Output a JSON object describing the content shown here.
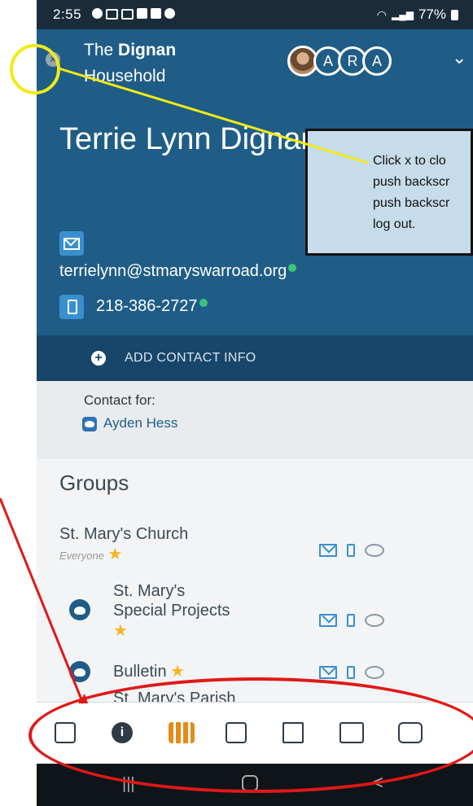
{
  "status_bar": {
    "time": "2:55",
    "battery": "77%"
  },
  "header": {
    "close_symbol": "×",
    "household_prefix": "The ",
    "household_name": "Dignan",
    "household_suffix": "Household",
    "avatar_letters": [
      "A",
      "R",
      "A"
    ],
    "chevron": "⌄"
  },
  "profile": {
    "name": "Terrie Lynn Dignan",
    "email": "terrielynn@stmaryswarroad.org",
    "phone": "218-386-2727"
  },
  "add_contact_label": "ADD CONTACT INFO",
  "contact_for": {
    "label": "Contact for:",
    "name": "Ayden Hess"
  },
  "groups": {
    "title": "Groups",
    "items": [
      {
        "name": "St. Mary's Church",
        "sub": "Everyone"
      },
      {
        "name_line1": "St. Mary's",
        "name_line2": "Special Projects"
      },
      {
        "name": "Bulletin"
      },
      {
        "name": "St. Mary's Parish"
      }
    ]
  },
  "bottom_nav": [
    "directory-icon",
    "info-icon",
    "groups-icon",
    "notes-icon",
    "copy-icon",
    "giving-icon",
    "wallet-icon"
  ],
  "android_nav": {
    "recent": "|||",
    "back": "<"
  },
  "callout": {
    "lines": [
      "Click x to clo",
      "push backscr",
      "push backscr",
      "log out."
    ]
  },
  "colors": {
    "primary": "#1f5d87",
    "accent": "#e58b1a",
    "annotation_yellow": "#f2ea16",
    "annotation_red": "#e01818"
  }
}
